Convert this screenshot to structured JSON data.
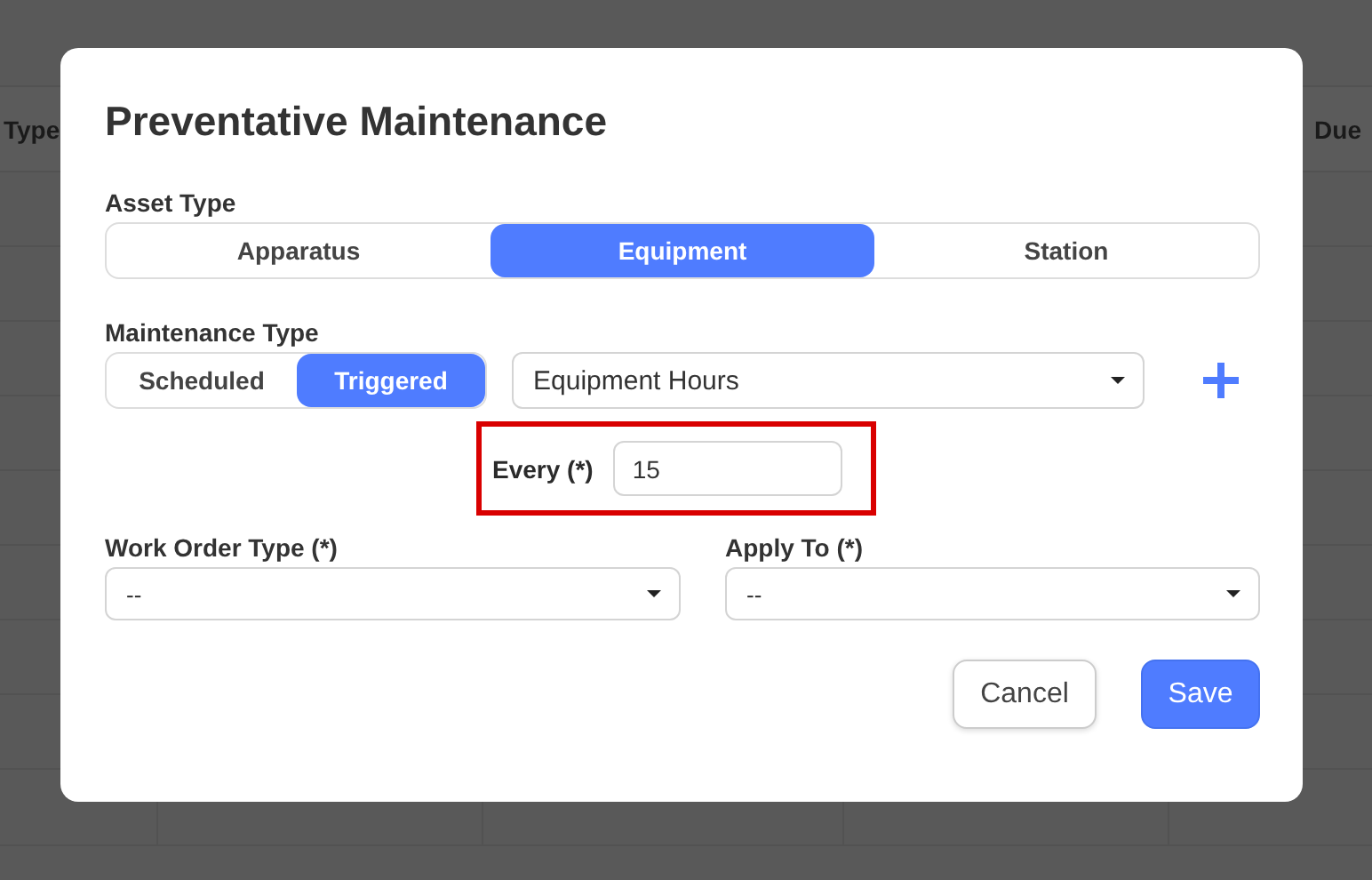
{
  "background_table": {
    "header": {
      "column_1": "Type",
      "column_last": "Due"
    }
  },
  "dialog": {
    "title": "Preventative Maintenance",
    "asset_type": {
      "label": "Asset Type",
      "options": [
        {
          "label": "Apparatus",
          "selected": false
        },
        {
          "label": "Equipment",
          "selected": true
        },
        {
          "label": "Station",
          "selected": false
        }
      ]
    },
    "maintenance_type": {
      "label": "Maintenance Type",
      "options": [
        {
          "label": "Scheduled",
          "selected": false
        },
        {
          "label": "Triggered",
          "selected": true
        }
      ],
      "trigger_select": "Equipment Hours"
    },
    "every": {
      "label": "Every (*)",
      "value": "15",
      "highlighted": true
    },
    "work_order_type": {
      "label": "Work Order Type (*)",
      "value": "--"
    },
    "apply_to": {
      "label": "Apply To (*)",
      "value": "--"
    },
    "buttons": [
      {
        "label": "Cancel",
        "kind": "secondary"
      },
      {
        "label": "Save",
        "kind": "primary"
      }
    ]
  }
}
